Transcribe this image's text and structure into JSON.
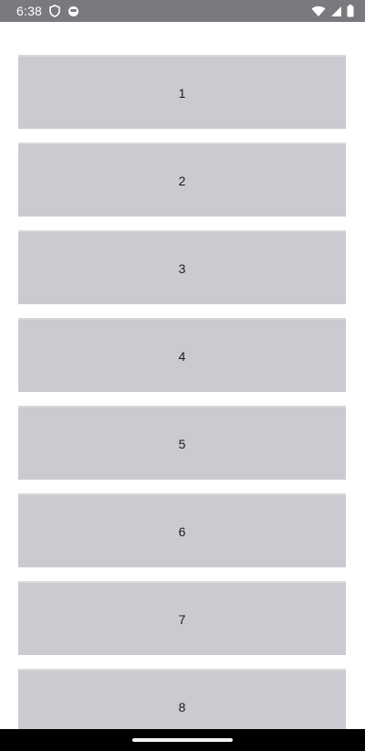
{
  "status_bar": {
    "time": "6:38",
    "icons_left": [
      "shield-icon",
      "face-icon"
    ],
    "icons_right": [
      "wifi-icon",
      "cellular-signal-icon",
      "battery-icon"
    ]
  },
  "list": {
    "items": [
      {
        "label": "1"
      },
      {
        "label": "2"
      },
      {
        "label": "3"
      },
      {
        "label": "4"
      },
      {
        "label": "5"
      },
      {
        "label": "6"
      },
      {
        "label": "7"
      },
      {
        "label": "8"
      }
    ]
  },
  "colors": {
    "status_bar": "#7a7a7e",
    "card": "#cbcad0",
    "background": "#ffffff",
    "nav_bar": "#000000"
  }
}
